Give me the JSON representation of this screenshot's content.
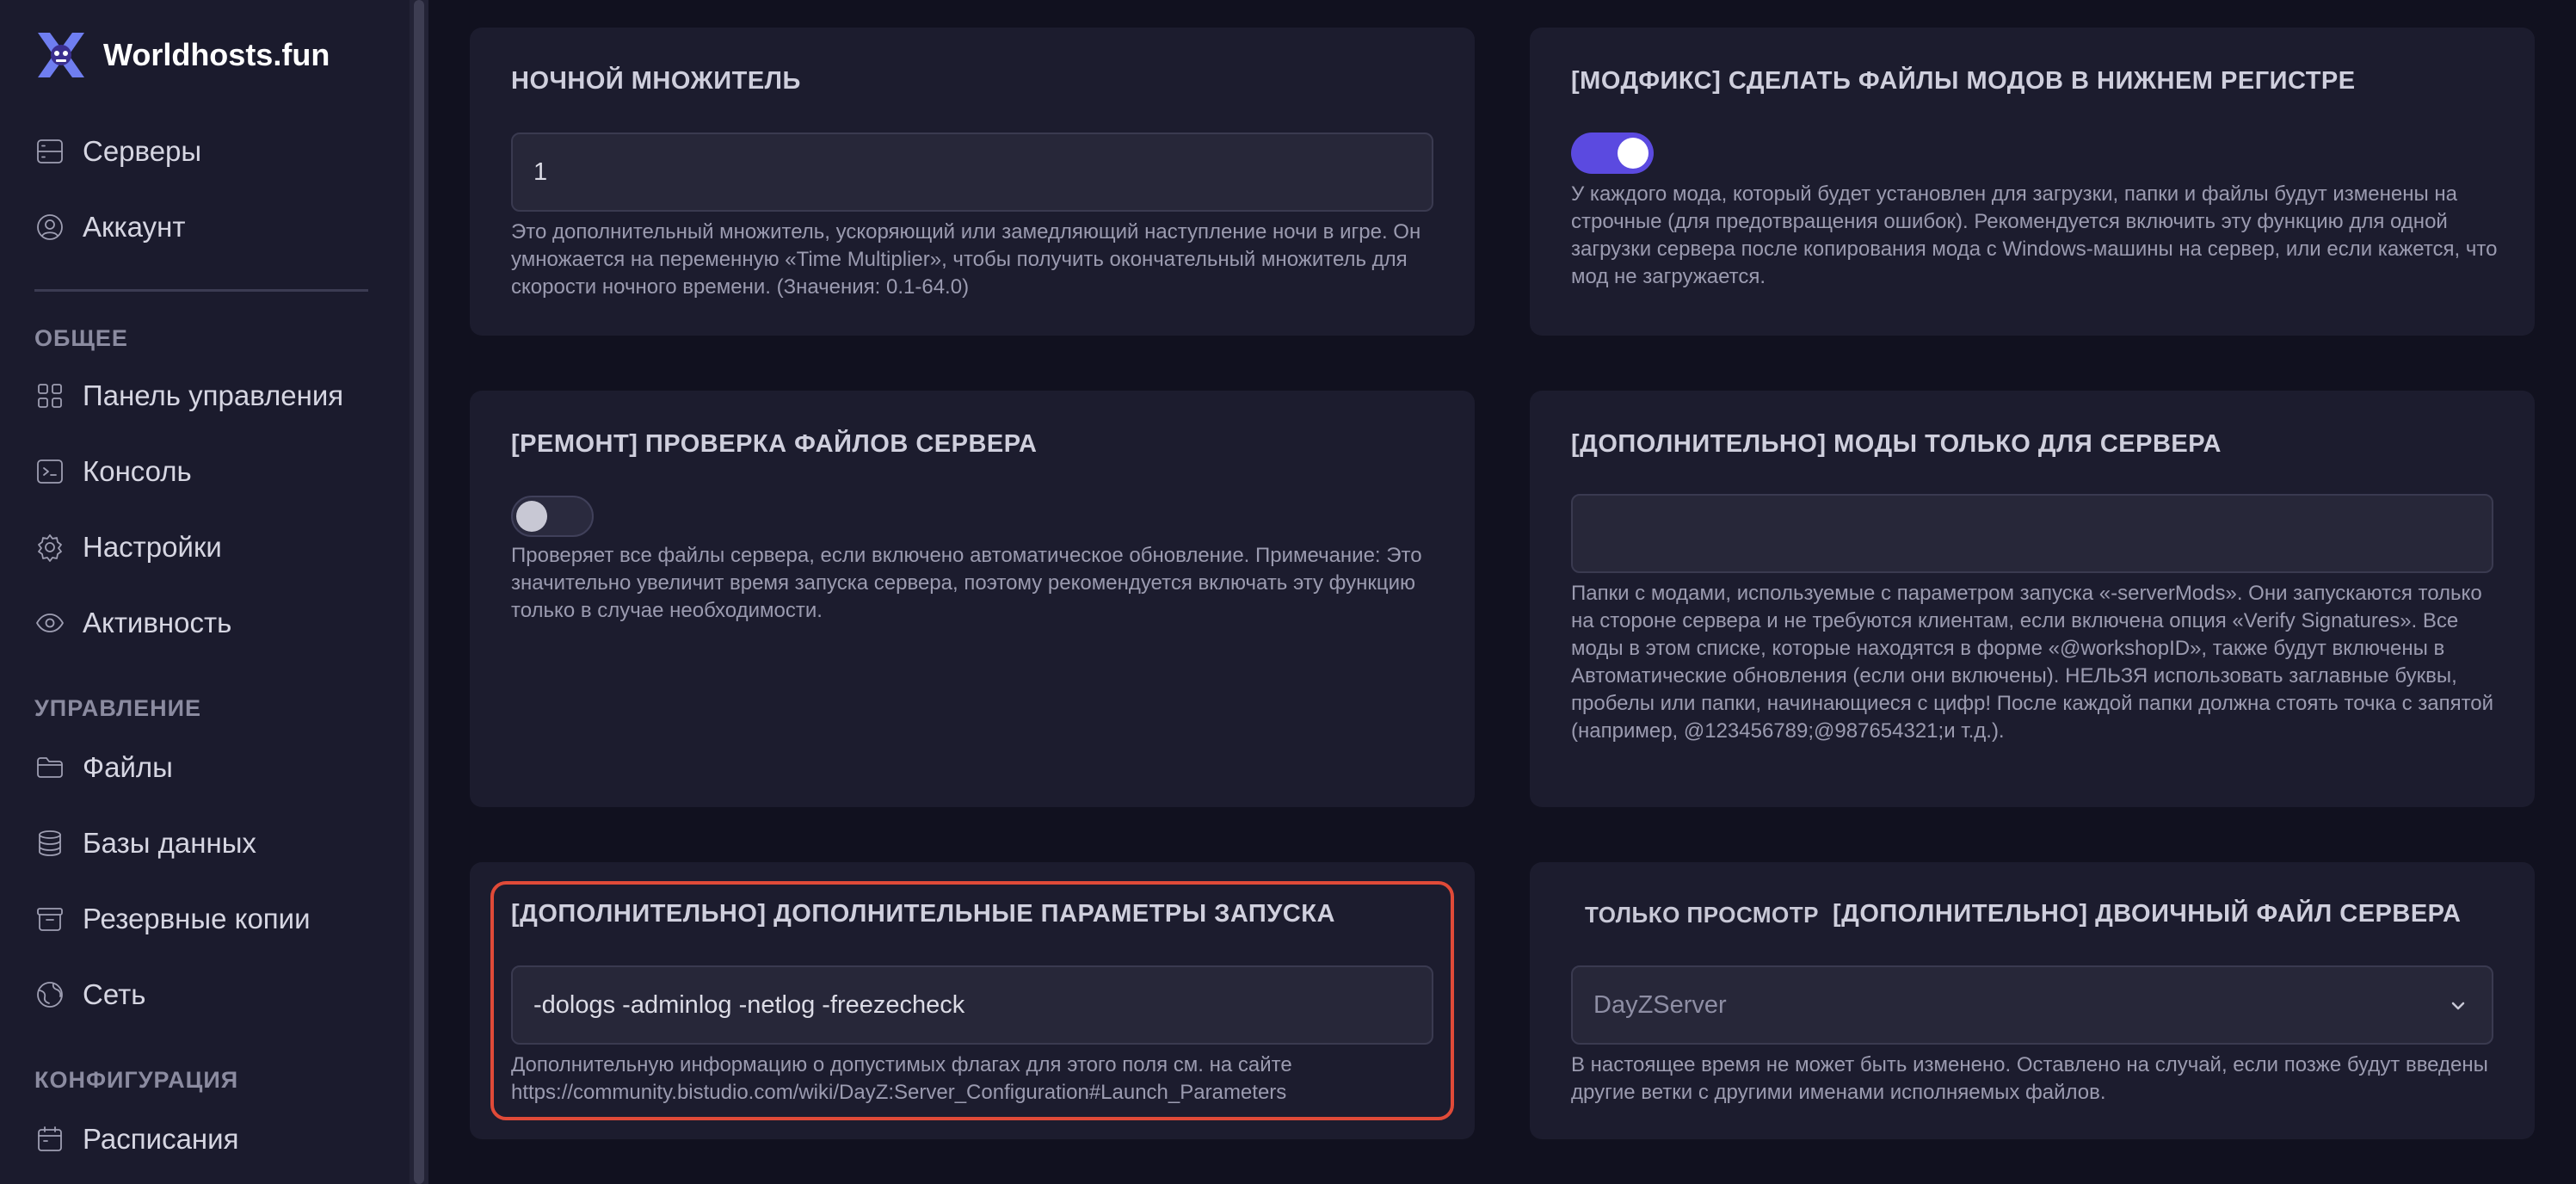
{
  "brand": {
    "name": "Worldhosts.fun"
  },
  "nav": {
    "servers": "Серверы",
    "account": "Аккаунт",
    "section_general": "ОБЩЕЕ",
    "dashboard": "Панель управления",
    "console": "Консоль",
    "settings": "Настройки",
    "activity": "Активность",
    "section_management": "УПРАВЛЕНИЕ",
    "files": "Файлы",
    "databases": "Базы данных",
    "backups": "Резервные копии",
    "network": "Сеть",
    "section_config": "КОНФИГУРАЦИЯ",
    "schedules": "Расписания"
  },
  "cards": {
    "night_multiplier": {
      "title": "НОЧНОЙ МНОЖИТЕЛЬ",
      "value": "1",
      "desc": "Это дополнительный множитель, ускоряющий или замедляющий наступление ночи в игре. Он умножается на переменную «Time Multiplier», чтобы получить окончательный множитель для скорости ночного времени. (Значения: 0.1-64.0)"
    },
    "modfix": {
      "title": "[МОДФИКС] СДЕЛАТЬ ФАЙЛЫ МОДОВ В НИЖНЕМ РЕГИСТРЕ",
      "enabled": true,
      "desc": "У каждого мода, который будет установлен для загрузки, папки и файлы будут изменены на строчные (для предотвращения ошибок). Рекомендуется включить эту функцию для одной загрузки сервера после копирования мода с Windows-машины на сервер, или если кажется, что мод не загружается."
    },
    "repair": {
      "title": "[РЕМОНТ] ПРОВЕРКА ФАЙЛОВ СЕРВЕРА",
      "enabled": false,
      "desc": "Проверяет все файлы сервера, если включено автоматическое обновление. Примечание: Это значительно увеличит время запуска сервера, поэтому рекомендуется включать эту функцию только в случае необходимости."
    },
    "server_mods": {
      "title": "[ДОПОЛНИТЕЛЬНО] МОДЫ ТОЛЬКО ДЛЯ СЕРВЕРА",
      "value": "",
      "desc": "Папки с модами, используемые с параметром запуска «-serverMods». Они запускаются только на стороне сервера и не требуются клиентам, если включена опция «Verify Signatures». Все моды в этом списке, которые находятся в форме «@workshopID», также будут включены в Автоматические обновления (если они включены). НЕЛЬЗЯ использовать заглавные буквы, пробелы или папки, начинающиеся с цифр! После каждой папки должна стоять точка с запятой (например, @123456789;@987654321;и т.д.)."
    },
    "launch_params": {
      "title": "[ДОПОЛНИТЕЛЬНО] ДОПОЛНИТЕЛЬНЫЕ ПАРАМЕТРЫ ЗАПУСКА",
      "value": "-dologs -adminlog -netlog -freezecheck",
      "desc": "Дополнительную информацию о допустимых флагах для этого поля см. на сайте https://community.bistudio.com/wiki/DayZ:Server_Configuration#Launch_Parameters"
    },
    "binary": {
      "badge": "ТОЛЬКО ПРОСМОТР",
      "title": "[ДОПОЛНИТЕЛЬНО] ДВОИЧНЫЙ ФАЙЛ СЕРВЕРА",
      "value": "DayZServer",
      "desc": "В настоящее время не может быть изменено. Оставлено на случай, если позже будут введены другие ветки с другими именами исполняемых файлов."
    }
  }
}
